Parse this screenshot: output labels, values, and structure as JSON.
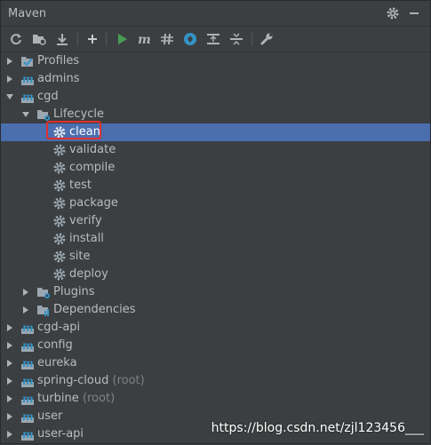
{
  "window": {
    "title": "Maven"
  },
  "toolbar": {
    "buttons": [
      {
        "icon": "reimport-icon"
      },
      {
        "icon": "generate-sources-icon"
      },
      {
        "icon": "download-icon"
      },
      {
        "icon": "add-icon"
      },
      {
        "icon": "run-icon"
      },
      {
        "icon": "execute-goal-icon"
      },
      {
        "icon": "skip-tests-icon"
      },
      {
        "icon": "offline-icon"
      },
      {
        "icon": "show-dependencies-icon"
      },
      {
        "icon": "collapse-all-icon"
      },
      {
        "icon": "settings-wrench-icon"
      }
    ]
  },
  "tree": {
    "profiles": "Profiles",
    "admins": "admins",
    "cgd": "cgd",
    "lifecycle": "Lifecycle",
    "goals": [
      "clean",
      "validate",
      "compile",
      "test",
      "package",
      "verify",
      "install",
      "site",
      "deploy"
    ],
    "plugins": "Plugins",
    "dependencies": "Dependencies",
    "projects": [
      {
        "name": "cgd-api",
        "suffix": ""
      },
      {
        "name": "config",
        "suffix": ""
      },
      {
        "name": "eureka",
        "suffix": ""
      },
      {
        "name": "spring-cloud",
        "suffix": "(root)"
      },
      {
        "name": "turbine",
        "suffix": "(root)"
      },
      {
        "name": "user",
        "suffix": ""
      },
      {
        "name": "user-api",
        "suffix": ""
      }
    ],
    "selected": "clean"
  },
  "watermark": "https://blog.csdn.net/zjl123456___",
  "colors": {
    "background": "#3c3f41",
    "selection": "#4b6eaf",
    "highlight_box": "#e0302e",
    "run_green": "#499c54"
  }
}
